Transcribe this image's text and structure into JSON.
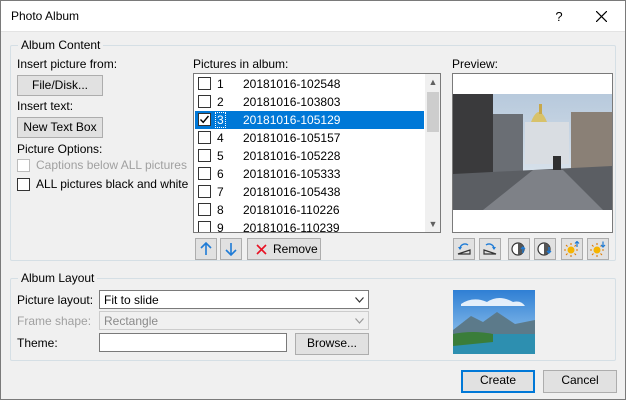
{
  "window": {
    "title": "Photo Album",
    "help_glyph": "?",
    "close_icon": "close-icon"
  },
  "album_content": {
    "group_label": "Album Content",
    "insert_picture_from": "Insert picture from:",
    "file_disk_button": "File/Disk...",
    "insert_text": "Insert text:",
    "new_text_box_button": "New Text Box",
    "picture_options": "Picture Options:",
    "captions_below_all_pictures": "Captions below ALL pictures",
    "all_pictures_black_and_white": "ALL pictures black and white",
    "pictures_in_album_label": "Pictures in album:",
    "pictures": [
      {
        "num": "1",
        "name": "20181016-102548",
        "checked": false,
        "selected": false
      },
      {
        "num": "2",
        "name": "20181016-103803",
        "checked": false,
        "selected": false
      },
      {
        "num": "3",
        "name": "20181016-105129",
        "checked": true,
        "selected": true
      },
      {
        "num": "4",
        "name": "20181016-105157",
        "checked": false,
        "selected": false
      },
      {
        "num": "5",
        "name": "20181016-105228",
        "checked": false,
        "selected": false
      },
      {
        "num": "6",
        "name": "20181016-105333",
        "checked": false,
        "selected": false
      },
      {
        "num": "7",
        "name": "20181016-105438",
        "checked": false,
        "selected": false
      },
      {
        "num": "8",
        "name": "20181016-110226",
        "checked": false,
        "selected": false
      },
      {
        "num": "9",
        "name": "20181016-110239",
        "checked": false,
        "selected": false
      }
    ],
    "remove_button": "Remove",
    "preview_label": "Preview:"
  },
  "album_layout": {
    "group_label": "Album Layout",
    "picture_layout_label": "Picture layout:",
    "picture_layout_value": "Fit to slide",
    "frame_shape_label": "Frame shape:",
    "frame_shape_value": "Rectangle",
    "theme_label": "Theme:",
    "theme_value": "",
    "browse_button": "Browse..."
  },
  "footer": {
    "create_button": "Create",
    "cancel_button": "Cancel"
  },
  "colors": {
    "selection": "#0078d7",
    "dialog_background": "#f0f0f0",
    "remove_x": "#e81123",
    "arrow_blue": "#1e7bd6"
  }
}
